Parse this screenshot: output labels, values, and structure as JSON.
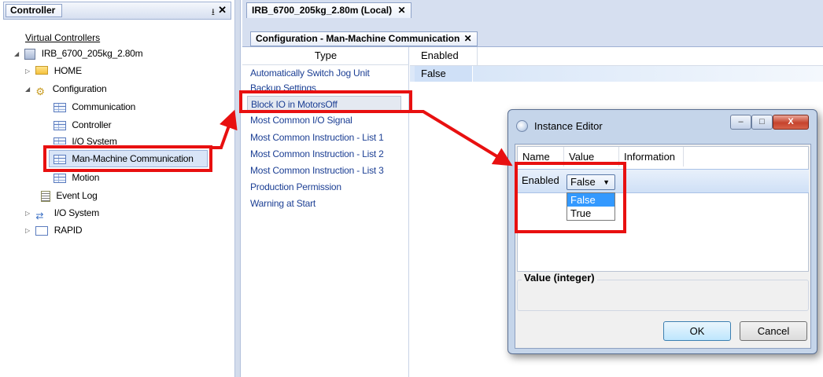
{
  "left_panel": {
    "title": "Controller",
    "pin_glyph": "⭳",
    "close_glyph": "✕",
    "virtual_controllers": "Virtual Controllers",
    "tree": {
      "controller": "IRB_6700_205kg_2.80m",
      "home": "HOME",
      "configuration": "Configuration",
      "communication": "Communication",
      "controller_item": "Controller",
      "io_system_conf": "I/O System",
      "man_machine": "Man-Machine Communication",
      "motion": "Motion",
      "event_log": "Event Log",
      "io_system": "I/O System",
      "rapid": "RAPID"
    }
  },
  "doc": {
    "tab_label": "IRB_6700_205kg_2.80m (Local)",
    "tab_close": "✕",
    "sub_tab_label": "Configuration - Man-Machine Communication",
    "sub_tab_close": "✕",
    "type_header": "Type",
    "types": [
      "Automatically Switch Jog Unit",
      "Backup Settings",
      "Block IO in MotorsOff",
      "Most Common I/O Signal",
      "Most Common Instruction - List 1",
      "Most Common Instruction - List 2",
      "Most Common Instruction - List 3",
      "Production Permission",
      "Warning at Start"
    ],
    "enabled_header": "Enabled",
    "enabled_value": "False"
  },
  "dialog": {
    "title": "Instance Editor",
    "min_glyph": "–",
    "max_glyph": "□",
    "close_glyph": "X",
    "columns": [
      "Name",
      "Value",
      "Information"
    ],
    "row_name": "Enabled",
    "selected_value": "False",
    "arrow_glyph": "▼",
    "options": [
      "False",
      "True"
    ],
    "value_type_label": "Value (integer)",
    "ok_label": "OK",
    "cancel_label": "Cancel"
  },
  "colors": {
    "highlight_red": "#e81010",
    "dropdown_selected": "#3399ff",
    "panel_header": "#d6dff0"
  }
}
